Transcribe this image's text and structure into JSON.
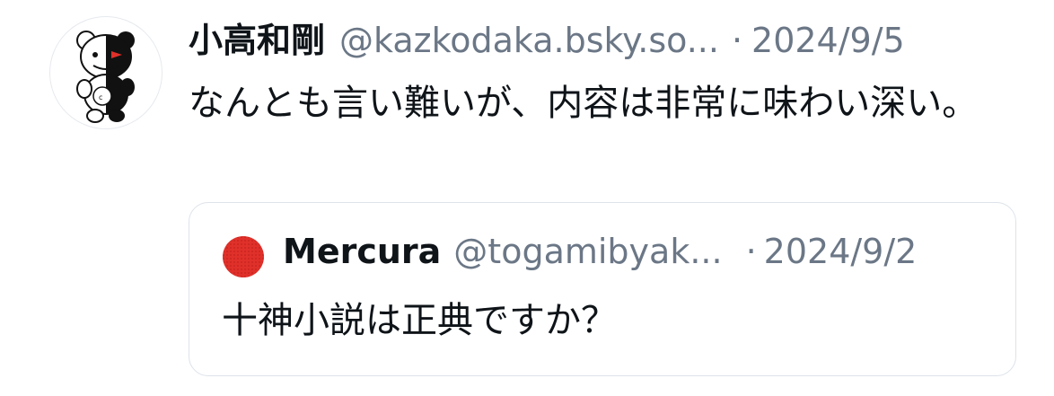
{
  "post": {
    "author_name": "小高和剛",
    "author_handle": "@kazkodaka.bsky.so...",
    "separator": "·",
    "date": "2024/9/5",
    "text": "なんとも言い難いが、内容は非常に味わい深い。",
    "avatar_icon": "monokuma-bear-avatar-icon"
  },
  "quoted_post": {
    "author_name": "Mercura",
    "author_handle": "@togamibyak...",
    "separator": "·",
    "date": "2024/9/2",
    "text": "十神小説は正典ですか？",
    "avatar_icon": "red-circle-avatar-icon",
    "avatar_color": "#e0302a"
  },
  "colors": {
    "primary_text": "#0f1419",
    "secondary_text": "#6b7786",
    "border": "#dde3ea"
  }
}
